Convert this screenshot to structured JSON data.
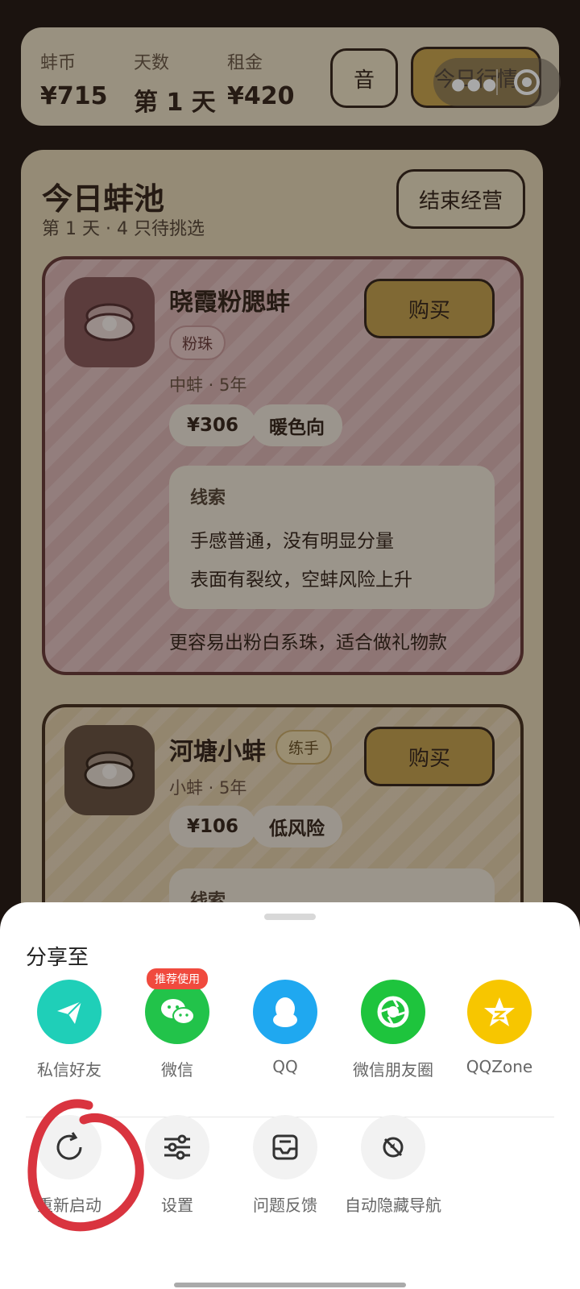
{
  "stats": {
    "coins_label": "蚌币",
    "coins_value": "¥715",
    "days_label": "天数",
    "days_value": "第 1 天",
    "rent_label": "租金",
    "rent_value": "¥420",
    "sound_button": "音",
    "market_button": "今日行情"
  },
  "pool": {
    "title": "今日蚌池",
    "subtitle": "第 1 天 · 4 只待挑选",
    "end_button": "结束经营",
    "cards": [
      {
        "name": "晓霞粉腮蚌",
        "tag": "粉珠",
        "meta": "中蚌 · 5年",
        "price": "¥306",
        "trait": "暖色向",
        "buy_label": "购买",
        "clue_title": "线索",
        "clues": [
          "手感普通，没有明显分量",
          "表面有裂纹，空蚌风险上升"
        ],
        "note": "更容易出粉白系珠，适合做礼物款"
      },
      {
        "name": "河塘小蚌",
        "tag": "练手",
        "meta": "小蚌 · 5年",
        "price": "¥106",
        "trait": "低风险",
        "buy_label": "购买",
        "clue_title": "线索"
      }
    ]
  },
  "share_sheet": {
    "title": "分享至",
    "recommend_badge": "推荐使用",
    "share_items": [
      {
        "label": "私信好友",
        "icon": "paper-plane-icon",
        "color": "#1fcfb8"
      },
      {
        "label": "微信",
        "icon": "wechat-icon",
        "color": "#22c34a"
      },
      {
        "label": "QQ",
        "icon": "qq-penguin-icon",
        "color": "#1fa8f0"
      },
      {
        "label": "微信朋友圈",
        "icon": "moments-shutter-icon",
        "color": "#1ec43d"
      },
      {
        "label": "QQZone",
        "icon": "qzone-star-icon",
        "color": "#f7c600"
      }
    ],
    "function_items": [
      {
        "label": "重新启动",
        "icon": "restart-icon"
      },
      {
        "label": "设置",
        "icon": "settings-sliders-icon"
      },
      {
        "label": "问题反馈",
        "icon": "feedback-inbox-icon"
      },
      {
        "label": "自动隐藏导航",
        "icon": "hide-navigation-icon"
      }
    ]
  },
  "colors": {
    "background": "#2a1d17",
    "panel": "#e2d3b3",
    "buy_button": "#c2a050",
    "annotation": "#d9343f"
  }
}
